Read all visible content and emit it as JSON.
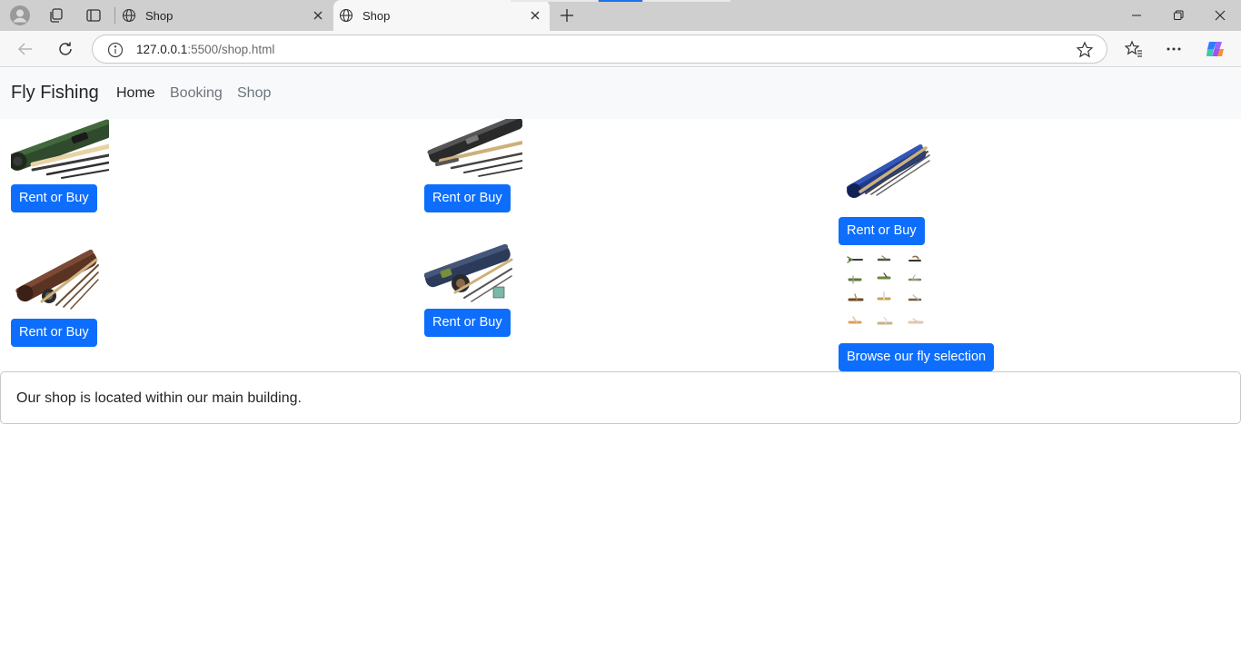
{
  "browser": {
    "tabs": [
      {
        "title": "Shop",
        "active": false
      },
      {
        "title": "Shop",
        "active": true
      }
    ],
    "url_host": "127.0.0.1",
    "url_path": ":5500/shop.html"
  },
  "navbar": {
    "brand": "Fly Fishing",
    "links": [
      {
        "label": "Home",
        "active": true
      },
      {
        "label": "Booking",
        "active": false
      },
      {
        "label": "Shop",
        "active": false
      }
    ]
  },
  "products": [
    {
      "image": "green-fly-rod-image",
      "button": "Rent or Buy"
    },
    {
      "image": "black-fly-rod-image",
      "button": "Rent or Buy"
    },
    {
      "image": "blue-fly-rod-image",
      "button": "Rent or Buy"
    },
    {
      "image": "brown-rod-and-reel-image",
      "button": "Rent or Buy"
    },
    {
      "image": "navy-rod-and-reel-kit-image",
      "button": "Rent or Buy"
    },
    {
      "image": "fly-assortment-image",
      "button": "Browse our fly selection"
    }
  ],
  "info": {
    "text": "Our shop is located within our main building."
  },
  "colors": {
    "primary_button": "#0d6efd",
    "navbar_bg": "#f8f9fa",
    "tabbar_bg": "#cfcfcf"
  }
}
